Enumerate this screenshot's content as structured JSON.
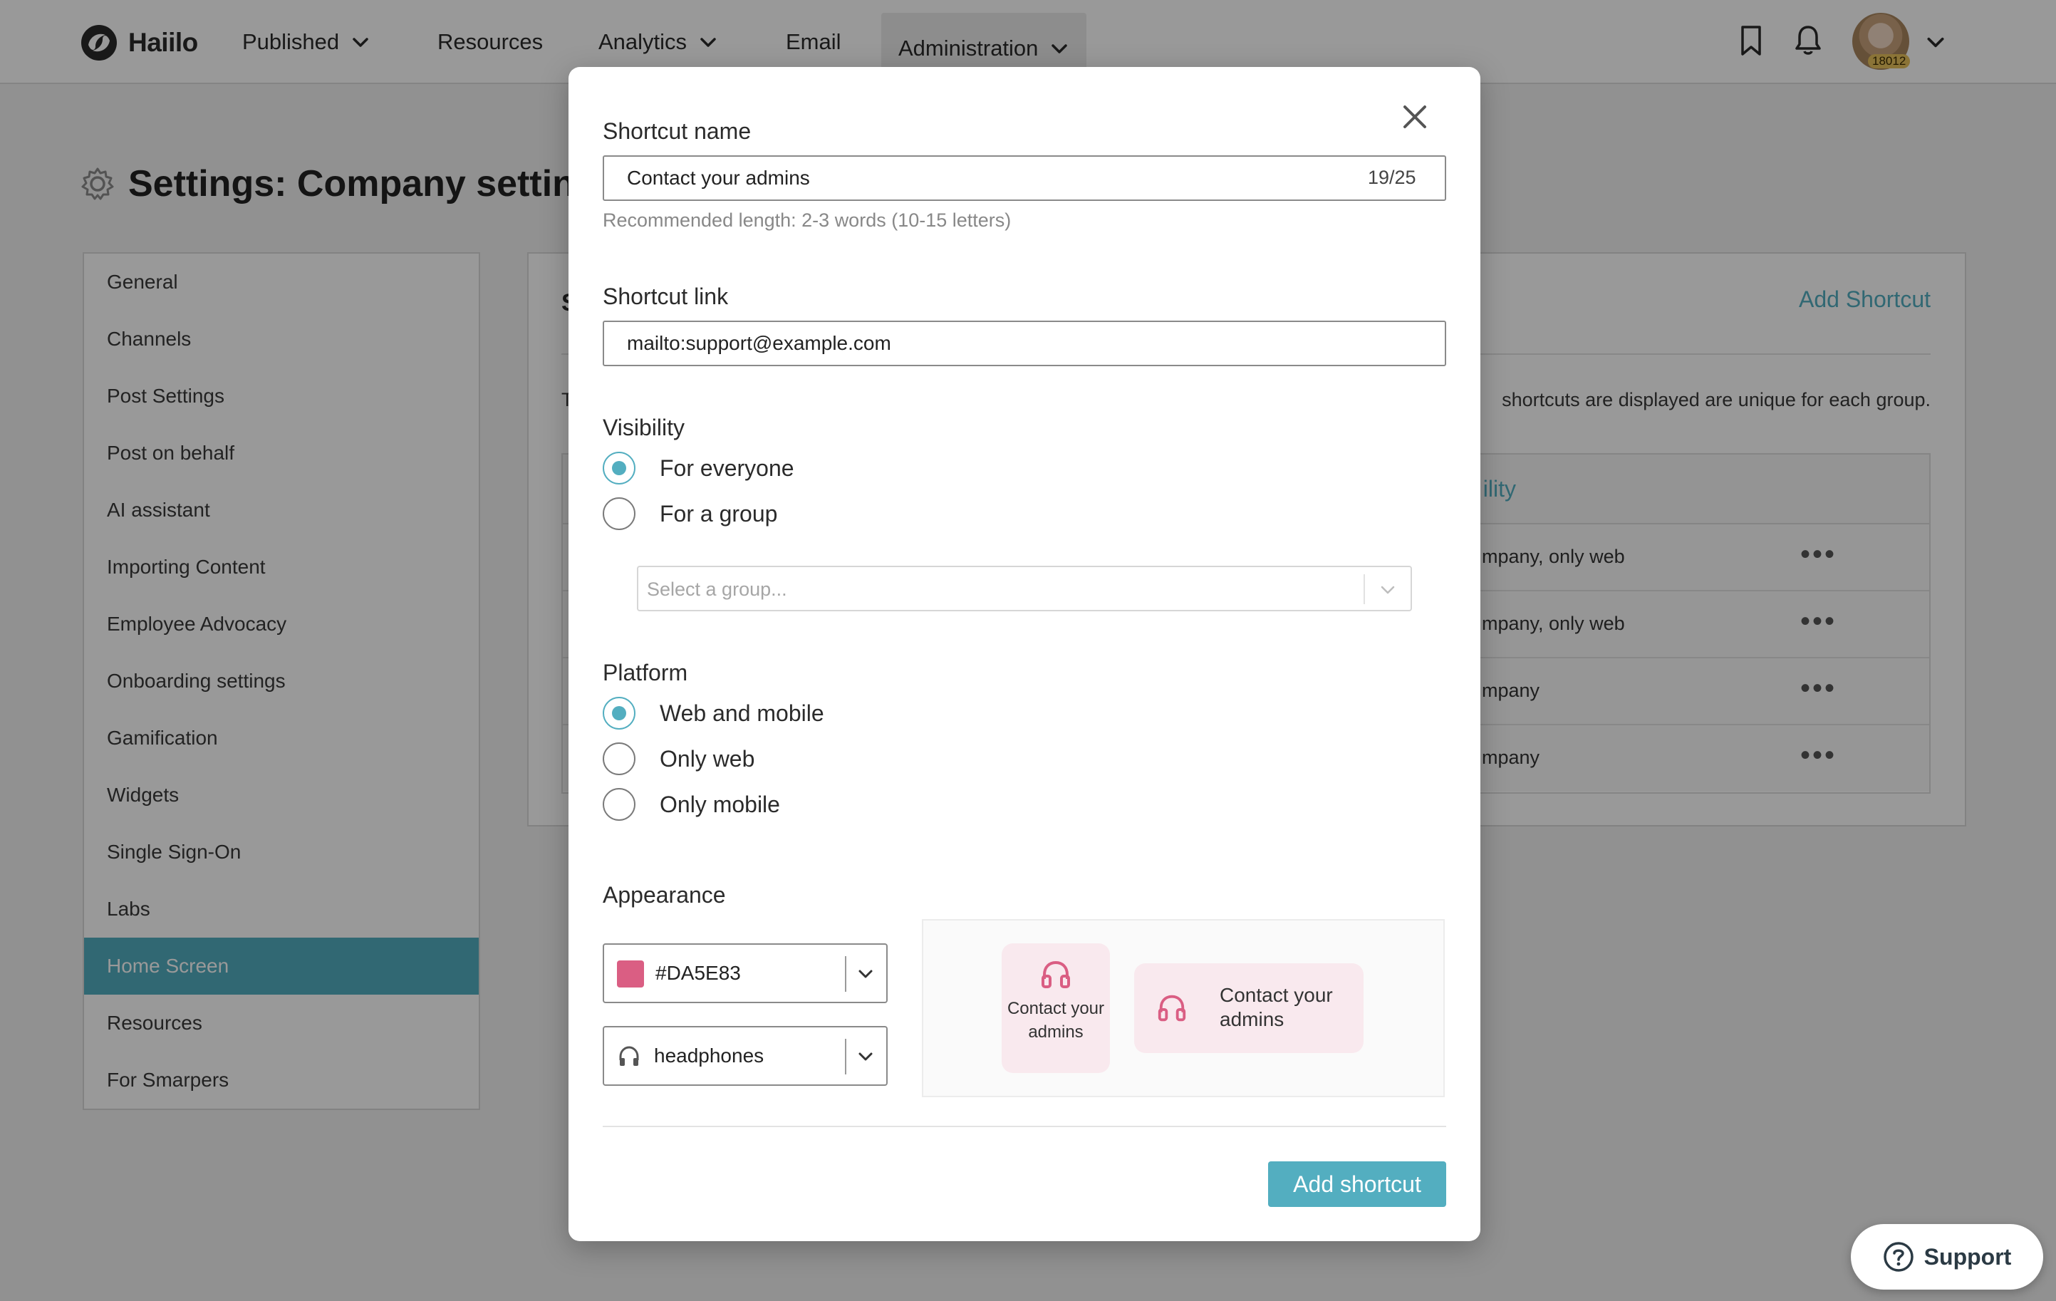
{
  "nav": {
    "brand": "Haiilo",
    "items": [
      {
        "label": "Published",
        "has_dropdown": true
      },
      {
        "label": "Resources",
        "has_dropdown": false
      },
      {
        "label": "Analytics",
        "has_dropdown": true
      },
      {
        "label": "Email",
        "has_dropdown": false
      },
      {
        "label": "Administration",
        "has_dropdown": true,
        "active": true
      }
    ],
    "avatar_badge": "18012"
  },
  "page": {
    "title": "Settings: Company settings"
  },
  "sidebar": {
    "items": [
      {
        "label": "General"
      },
      {
        "label": "Channels"
      },
      {
        "label": "Post Settings"
      },
      {
        "label": "Post on behalf"
      },
      {
        "label": "AI assistant"
      },
      {
        "label": "Importing Content"
      },
      {
        "label": "Employee Advocacy"
      },
      {
        "label": "Onboarding settings"
      },
      {
        "label": "Gamification"
      },
      {
        "label": "Widgets"
      },
      {
        "label": "Single Sign-On"
      },
      {
        "label": "Labs"
      },
      {
        "label": "Home Screen",
        "active": true
      },
      {
        "label": "Resources"
      },
      {
        "label": "For Smarpers"
      }
    ]
  },
  "panel": {
    "title_partial": "S",
    "add_link": "Add Shortcut",
    "desc_partial_start": "T",
    "desc_partial_end": "shortcuts are displayed are unique for each group.",
    "visibility_header_partial": "ility",
    "rows": [
      {
        "visibility_partial": "mpany, only web"
      },
      {
        "visibility_partial": "mpany, only web"
      },
      {
        "visibility_partial": "mpany"
      },
      {
        "visibility_partial": "mpany"
      }
    ]
  },
  "modal": {
    "name": {
      "label": "Shortcut name",
      "value": "Contact your admins",
      "counter": "19/25",
      "hint": "Recommended length: 2-3 words (10-15 letters)"
    },
    "link": {
      "label": "Shortcut link",
      "value": "mailto:support@example.com"
    },
    "visibility": {
      "label": "Visibility",
      "options": [
        "For everyone",
        "For a group"
      ],
      "selected": "For everyone",
      "group_placeholder": "Select a group..."
    },
    "platform": {
      "label": "Platform",
      "options": [
        "Web and mobile",
        "Only web",
        "Only mobile"
      ],
      "selected": "Web and mobile"
    },
    "appearance": {
      "label": "Appearance",
      "color_value": "#DA5E83",
      "icon_value": "headphones",
      "icon_semantic": "headphones-icon",
      "preview_label": "Contact your admins"
    },
    "submit_label": "Add shortcut"
  },
  "support": {
    "label": "Support"
  },
  "colors": {
    "accent": "#53aec0",
    "shortcut_color": "#DA5E83",
    "tile_bg": "#f9e9ee"
  }
}
